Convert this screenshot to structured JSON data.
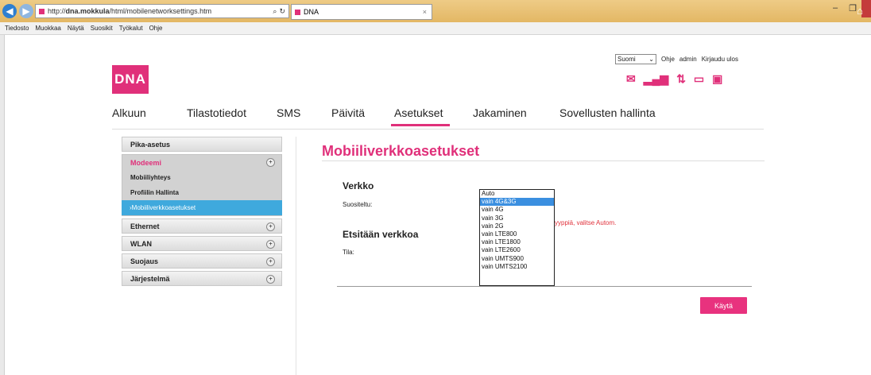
{
  "browser": {
    "url_prefix": "http://",
    "url_host": "dna.mokkula",
    "url_path": "/html/mobilenetworksettings.htm",
    "tab_title": "DNA",
    "tab_close": "×",
    "search_glyph": "⌕",
    "menu": [
      "Tiedosto",
      "Muokkaa",
      "Näytä",
      "Suosikit",
      "Työkalut",
      "Ohje"
    ]
  },
  "header": {
    "logo_text": "DNA",
    "language": "Suomi",
    "links": [
      "Ohje",
      "admin",
      "Kirjaudu ulos"
    ]
  },
  "nav": [
    "Alkuun",
    "Tilastotiedot",
    "SMS",
    "Päivitä",
    "Asetukset",
    "Jakaminen",
    "Sovellusten hallinta"
  ],
  "nav_active": "Asetukset",
  "sidebar": {
    "pika": "Pika-asetus",
    "modeemi": "Modeemi",
    "sub": [
      "Mobiiliyhteys",
      "Profiilin Hallinta",
      "Mobiiliverkkoasetukset"
    ],
    "sections": [
      "Ethernet",
      "WLAN",
      "Suojaus",
      "Järjestelmä"
    ]
  },
  "content": {
    "title": "Mobiiliverkkoasetukset",
    "verkko_heading": "Verkko",
    "suositeltu_label": "Suositeltu:",
    "warning": "yyppiä, valitse Autom.",
    "etsitaan_heading": "Etsitään verkkoa",
    "tila_label": "Tila:",
    "apply_label": "Käytä"
  },
  "dropdown": {
    "options": [
      "Auto",
      "vain 4G&3G",
      "vain 4G",
      "vain 3G",
      "vain 2G",
      "vain LTE800",
      "vain LTE1800",
      "vain LTE2600",
      "vain UMTS900",
      "vain UMTS2100"
    ],
    "selected_index": 1
  },
  "colors": {
    "brand": "#e0307a",
    "selection": "#3fa9dd"
  }
}
